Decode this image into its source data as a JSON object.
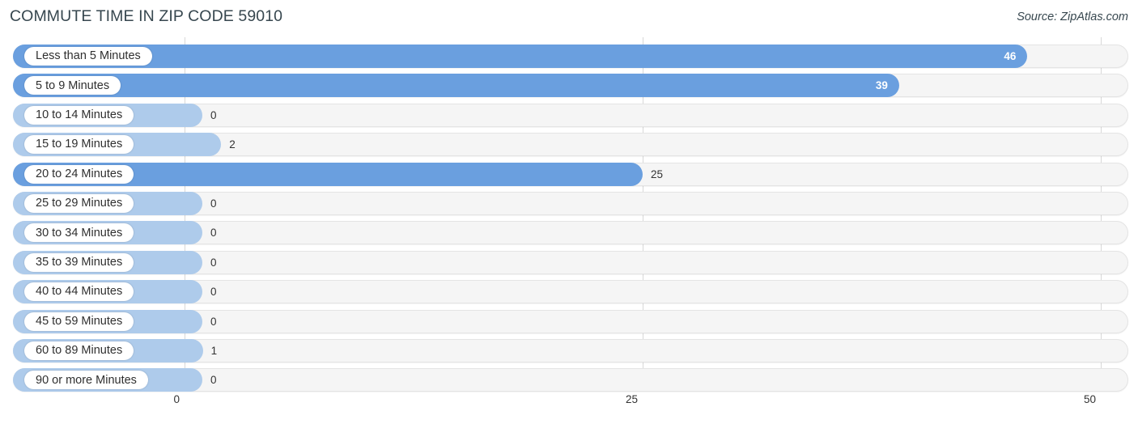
{
  "header": {
    "title": "COMMUTE TIME IN ZIP CODE 59010",
    "source": "Source: ZipAtlas.com"
  },
  "colors": {
    "bar_strong": "#6a9fdf",
    "bar_weak": "#aecbeb",
    "track": "#f5f5f5",
    "gridline": "#d8d8d8",
    "title_text": "#37474f",
    "value_text": "#333333",
    "value_text_inside": "#ffffff"
  },
  "chart_data": {
    "type": "bar",
    "orientation": "horizontal",
    "title": "COMMUTE TIME IN ZIP CODE 59010",
    "xlabel": "",
    "ylabel": "",
    "xlim": [
      0,
      50
    ],
    "xticks": [
      0,
      25,
      50
    ],
    "xtick_labels": [
      "0",
      "25",
      "50"
    ],
    "grid": true,
    "legend": null,
    "categories": [
      "Less than 5 Minutes",
      "5 to 9 Minutes",
      "10 to 14 Minutes",
      "15 to 19 Minutes",
      "20 to 24 Minutes",
      "25 to 29 Minutes",
      "30 to 34 Minutes",
      "35 to 39 Minutes",
      "40 to 44 Minutes",
      "45 to 59 Minutes",
      "60 to 89 Minutes",
      "90 or more Minutes"
    ],
    "values": [
      46,
      39,
      0,
      2,
      25,
      0,
      0,
      0,
      0,
      0,
      1,
      0
    ],
    "value_labels": [
      "46",
      "39",
      "0",
      "2",
      "25",
      "0",
      "0",
      "0",
      "0",
      "0",
      "1",
      "0"
    ]
  },
  "rows": [
    {
      "label": "Less than 5 Minutes",
      "value": 46,
      "value_label": "46",
      "tone": "strong",
      "label_inside": true
    },
    {
      "label": "5 to 9 Minutes",
      "value": 39,
      "value_label": "39",
      "tone": "strong",
      "label_inside": true
    },
    {
      "label": "10 to 14 Minutes",
      "value": 0,
      "value_label": "0",
      "tone": "weak",
      "label_inside": false
    },
    {
      "label": "15 to 19 Minutes",
      "value": 2,
      "value_label": "2",
      "tone": "weak",
      "label_inside": false
    },
    {
      "label": "20 to 24 Minutes",
      "value": 25,
      "value_label": "25",
      "tone": "strong",
      "label_inside": false
    },
    {
      "label": "25 to 29 Minutes",
      "value": 0,
      "value_label": "0",
      "tone": "weak",
      "label_inside": false
    },
    {
      "label": "30 to 34 Minutes",
      "value": 0,
      "value_label": "0",
      "tone": "weak",
      "label_inside": false
    },
    {
      "label": "35 to 39 Minutes",
      "value": 0,
      "value_label": "0",
      "tone": "weak",
      "label_inside": false
    },
    {
      "label": "40 to 44 Minutes",
      "value": 0,
      "value_label": "0",
      "tone": "weak",
      "label_inside": false
    },
    {
      "label": "45 to 59 Minutes",
      "value": 0,
      "value_label": "0",
      "tone": "weak",
      "label_inside": false
    },
    {
      "label": "60 to 89 Minutes",
      "value": 1,
      "value_label": "1",
      "tone": "weak",
      "label_inside": false
    },
    {
      "label": "90 or more Minutes",
      "value": 0,
      "value_label": "0",
      "tone": "weak",
      "label_inside": false
    }
  ],
  "axis": {
    "ticks": [
      {
        "label": "0",
        "value": 0
      },
      {
        "label": "25",
        "value": 25
      },
      {
        "label": "50",
        "value": 50
      }
    ]
  }
}
